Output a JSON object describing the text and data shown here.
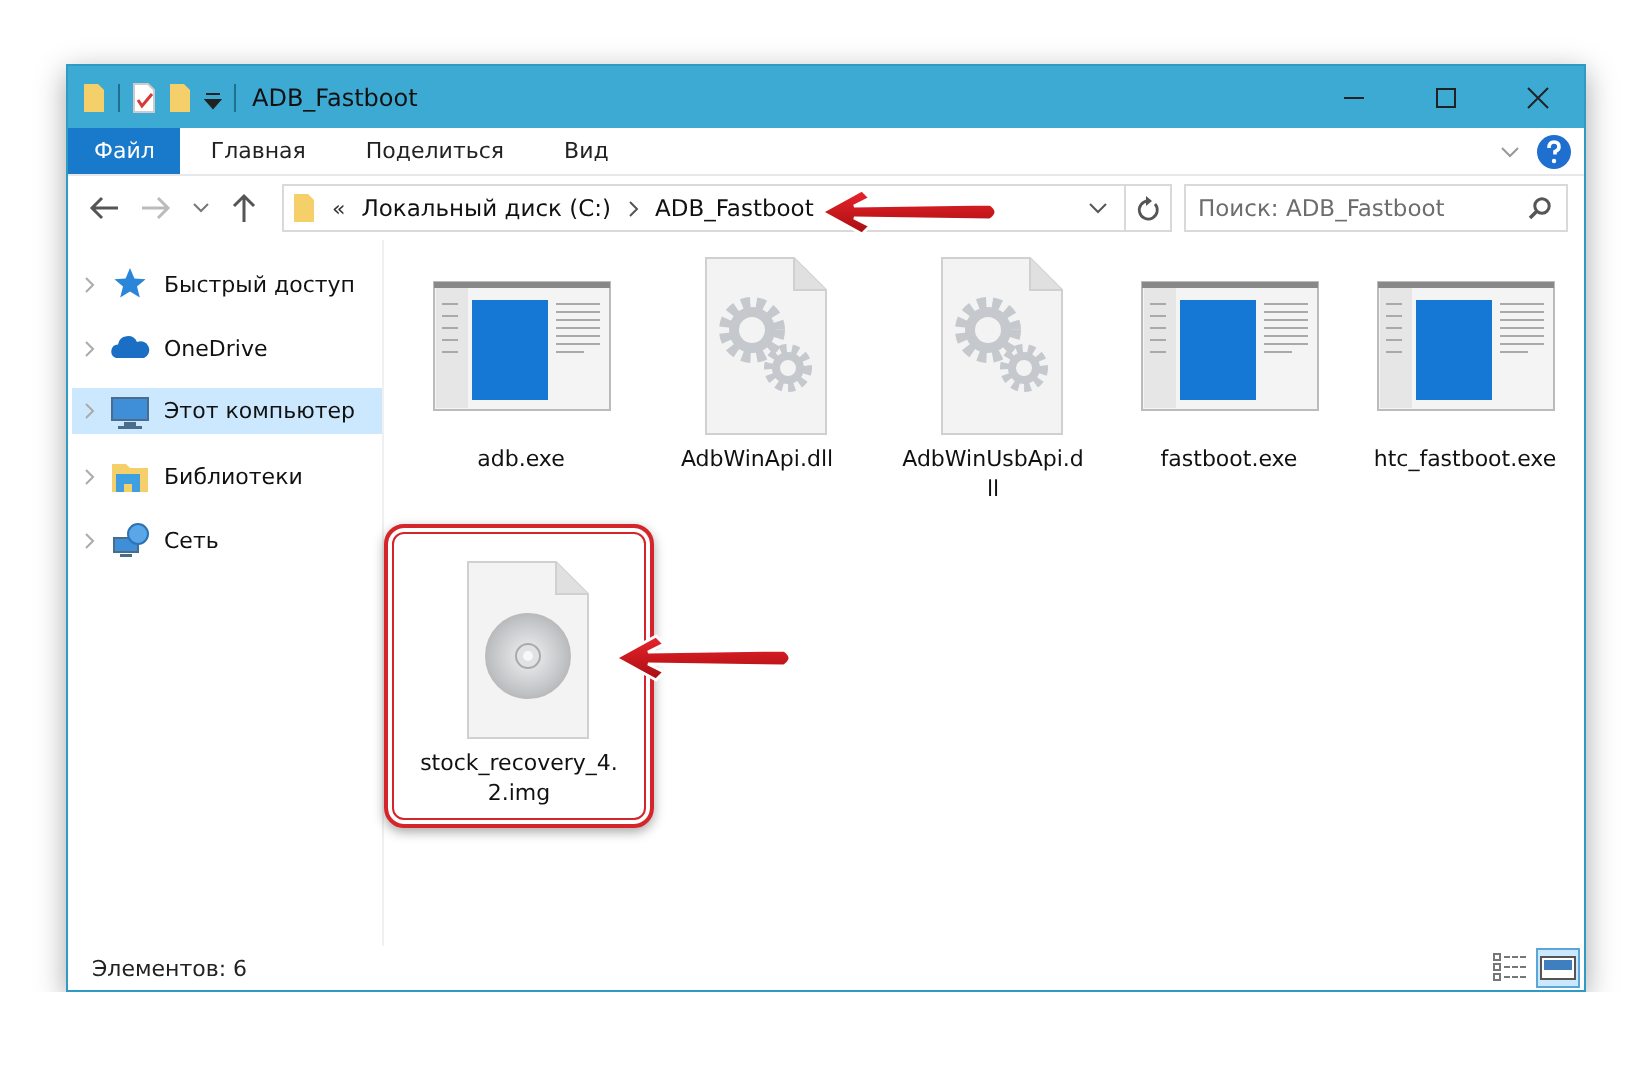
{
  "window": {
    "title": "ADB_Fastboot"
  },
  "ribbon_tabs": [
    {
      "label": "Файл",
      "selected": true
    },
    {
      "label": "Главная",
      "selected": false
    },
    {
      "label": "Поделиться",
      "selected": false
    },
    {
      "label": "Вид",
      "selected": false
    }
  ],
  "address_bar": {
    "overflow": "«",
    "crumbs": [
      {
        "label": "Локальный диск (C:)",
        "arrow": false
      },
      {
        "label": "ADB_Fastboot",
        "arrow": true
      }
    ]
  },
  "search": {
    "placeholder": "Поиск: ADB_Fastboot"
  },
  "sidebar": {
    "items": [
      {
        "label": "Быстрый доступ",
        "kind": "star",
        "selected": false
      },
      {
        "label": "OneDrive",
        "kind": "cloud",
        "selected": false
      },
      {
        "label": "Этот компьютер",
        "kind": "computer",
        "selected": true
      },
      {
        "label": "Библиотеки",
        "kind": "library",
        "selected": false
      },
      {
        "label": "Сеть",
        "kind": "network",
        "selected": false
      }
    ]
  },
  "files": [
    {
      "name": "adb.exe",
      "kind": "exe",
      "highlight": false,
      "arrow": false
    },
    {
      "name": "AdbWinApi.dll",
      "kind": "dll",
      "highlight": false,
      "arrow": false
    },
    {
      "name": "AdbWinUsbApi.d\nll",
      "kind": "dll",
      "highlight": false,
      "arrow": false
    },
    {
      "name": "fastboot.exe",
      "kind": "exe",
      "highlight": false,
      "arrow": false
    },
    {
      "name": "htc_fastboot.exe",
      "kind": "exe",
      "highlight": false,
      "arrow": false
    },
    {
      "name": "stock_recovery_4.\n2.img",
      "kind": "img",
      "highlight": true,
      "arrow": true
    }
  ],
  "status_bar": {
    "text": "Элементов: 6",
    "views": [
      {
        "kind": "details",
        "selected": false
      },
      {
        "kind": "icons",
        "selected": true
      }
    ]
  }
}
